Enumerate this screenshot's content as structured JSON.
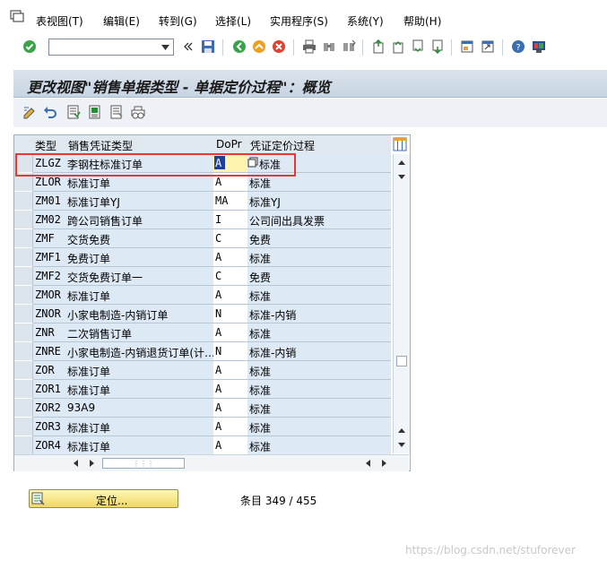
{
  "menu": {
    "items": [
      {
        "label": "表视图(T)"
      },
      {
        "label": "编辑(E)"
      },
      {
        "label": "转到(G)"
      },
      {
        "label": "选择(L)"
      },
      {
        "label": "实用程序(S)"
      },
      {
        "label": "系统(Y)"
      },
      {
        "label": "帮助(H)"
      }
    ]
  },
  "toolbar": {
    "command_value": "",
    "command_placeholder": ""
  },
  "title": "更改视图\"销售单据类型 - 单据定价过程\"：概览",
  "table": {
    "headers": [
      "类型",
      "销售凭证类型",
      "DoPr",
      "凭证定价过程"
    ],
    "rows": [
      {
        "type": "ZLGZ",
        "name": "李钢柱标准订单",
        "dopr": "A",
        "proc": "标准"
      },
      {
        "type": "ZLOR",
        "name": "标准订单",
        "dopr": "A",
        "proc": "标准"
      },
      {
        "type": "ZM01",
        "name": "标准订单YJ",
        "dopr": "MA",
        "proc": "标准YJ"
      },
      {
        "type": "ZM02",
        "name": "跨公司销售订单",
        "dopr": "I",
        "proc": "公司间出具发票"
      },
      {
        "type": "ZMF",
        "name": "交货免费",
        "dopr": "C",
        "proc": "免费"
      },
      {
        "type": "ZMF1",
        "name": "免费订单",
        "dopr": "A",
        "proc": "标准"
      },
      {
        "type": "ZMF2",
        "name": "交货免费订单一",
        "dopr": "C",
        "proc": "免费"
      },
      {
        "type": "ZMOR",
        "name": "标准订单",
        "dopr": "A",
        "proc": "标准"
      },
      {
        "type": "ZNOR",
        "name": "小家电制造-内销订单",
        "dopr": "N",
        "proc": "标准-内销"
      },
      {
        "type": "ZNR",
        "name": "二次销售订单",
        "dopr": "A",
        "proc": "标准"
      },
      {
        "type": "ZNRE",
        "name": "小家电制造-内销退货订单(计…",
        "dopr": "N",
        "proc": "标准-内销"
      },
      {
        "type": "ZOR",
        "name": "标准订单",
        "dopr": "A",
        "proc": "标准"
      },
      {
        "type": "ZOR1",
        "name": "标准订单",
        "dopr": "A",
        "proc": "标准"
      },
      {
        "type": "ZOR2",
        "name": "93A9",
        "dopr": "A",
        "proc": "标准"
      },
      {
        "type": "ZOR3",
        "name": "标准订单",
        "dopr": "A",
        "proc": "标准"
      },
      {
        "type": "ZOR4",
        "name": "标准订单",
        "dopr": "A",
        "proc": "标准"
      }
    ]
  },
  "position_button": "定位...",
  "entries": "条目 349 / 455",
  "watermark": "https://blog.csdn.net/stuforever",
  "colors": {
    "cell_blue": "#dde9f4",
    "highlight_red": "#e53935",
    "button_yellow": "#f0d866",
    "cursor_blue": "#1f3f9c"
  }
}
